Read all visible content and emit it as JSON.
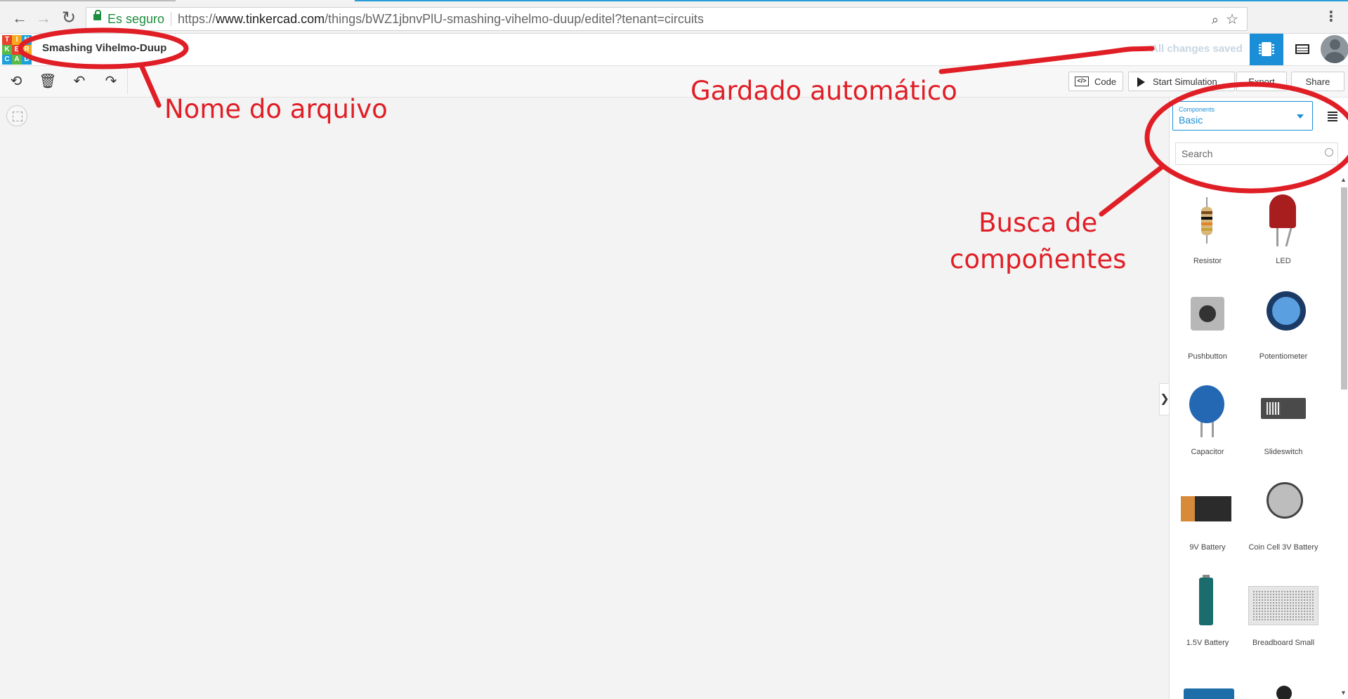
{
  "browser": {
    "secure_label": "Es seguro",
    "url_scheme": "https://",
    "url_host": "www.tinkercad.com",
    "url_path": "/things/bWZ1jbnvPlU-smashing-vihelmo-duup/editel?tenant=circuits",
    "icons": [
      "back-arrow-icon",
      "forward-arrow-icon",
      "reload-icon",
      "lock-icon",
      "zoom-icon",
      "star-icon",
      "menu-dots-icon"
    ]
  },
  "header": {
    "logo_letters": [
      "T",
      "I",
      "N",
      "K",
      "E",
      "R",
      "C",
      "A",
      "D"
    ],
    "logo_colors": [
      "#e8412c",
      "#f7a81b",
      "#1d9fd9",
      "#57b947",
      "#e8412c",
      "#f7a81b",
      "#1d9fd9",
      "#57b947",
      "#1d9fd9"
    ],
    "project_name": "Smashing Vihelmo-Duup",
    "save_status": "All changes saved",
    "accent_color": "#1a8fd8"
  },
  "toolbar": {
    "code_label": "Code",
    "simulate_label": "Start Simulation",
    "export_label": "Export",
    "share_label": "Share"
  },
  "panel": {
    "select_label": "Components",
    "select_value": "Basic",
    "search_placeholder": "Search",
    "toggle_glyph": "❯",
    "components": [
      {
        "name": "Resistor"
      },
      {
        "name": "LED"
      },
      {
        "name": "Pushbutton"
      },
      {
        "name": "Potentiometer"
      },
      {
        "name": "Capacitor"
      },
      {
        "name": "Slideswitch"
      },
      {
        "name": "9V Battery"
      },
      {
        "name": "Coin Cell 3V Battery"
      },
      {
        "name": "1.5V Battery"
      },
      {
        "name": "Breadboard Small"
      },
      {
        "name": ""
      },
      {
        "name": ""
      }
    ]
  },
  "annotations": {
    "file_name": "Nome do arquivo",
    "autosave": "Gardado automático",
    "search_line1": "Busca de",
    "search_line2": "compoñentes",
    "color": "#e01e26"
  }
}
